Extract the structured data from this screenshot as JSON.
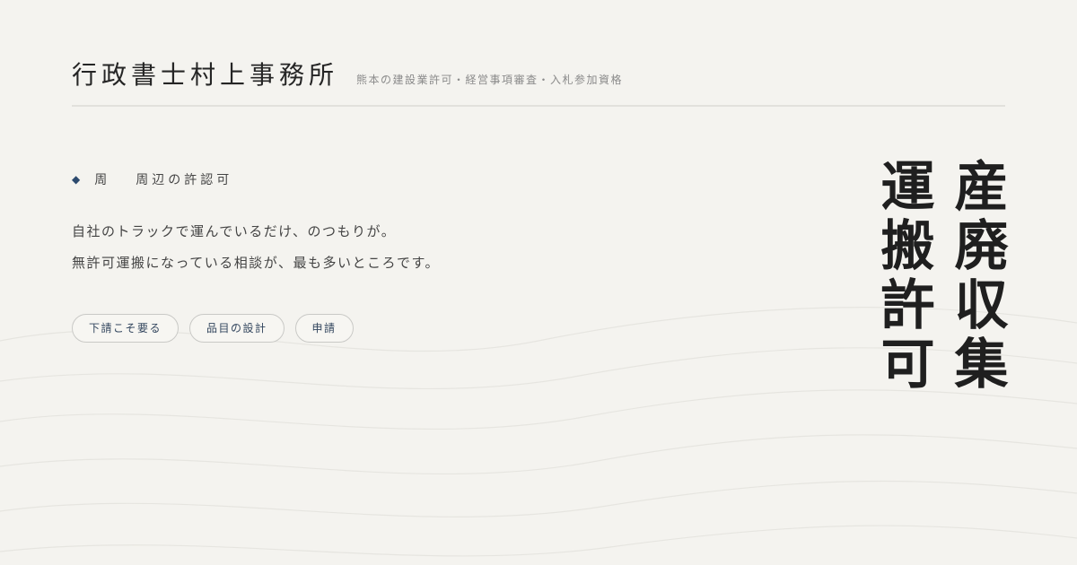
{
  "header": {
    "office_name": "行政書士村上事務所",
    "tagline": "熊本の建設業許可・経営事項審査・入札参加資格"
  },
  "section": {
    "marker_icon": "diamond-icon",
    "label_short": "周",
    "label_full": "周辺の許認可"
  },
  "body": {
    "line1": "自社のトラックで運んでいるだけ、のつもりが。",
    "line2": "無許可運搬になっている相談が、最も多いところです。"
  },
  "chips": [
    {
      "label": "下請こそ要る"
    },
    {
      "label": "品目の設計"
    },
    {
      "label": "申請"
    }
  ],
  "vertical_title": {
    "column1": "産廃収集",
    "column2": "運搬許可"
  },
  "colors": {
    "background": "#f4f3ef",
    "accent": "#2c4a6e",
    "text": "#2b2b2b"
  }
}
